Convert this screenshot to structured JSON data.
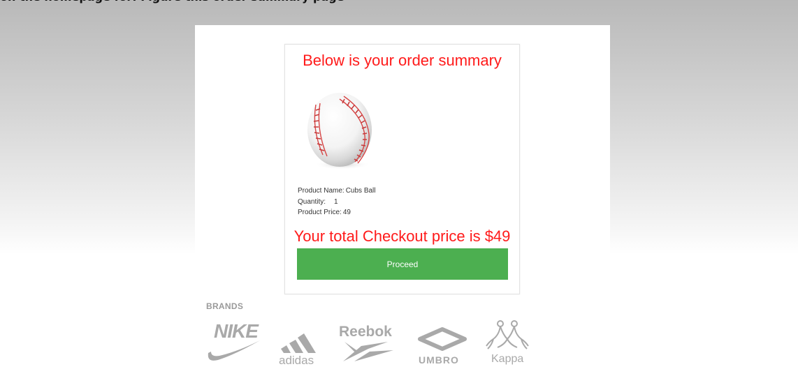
{
  "caption": "on the homepage for: Figure this order summary page",
  "order_summary": {
    "title": "Below is your order summary",
    "product_image_icon": "baseball-image",
    "product_name_label": "Product Name:",
    "product_name_value": "Cubs Ball",
    "quantity_label": "Quantity:",
    "quantity_value": "1",
    "price_label": "Product Price:",
    "price_value": "49",
    "total_text": "Your total Checkout price is $49",
    "proceed_label": "Proceed"
  },
  "brands": {
    "heading": "BRANDS",
    "items": [
      {
        "name": "NIKE",
        "icon": "nike-logo"
      },
      {
        "name": "adidas",
        "icon": "adidas-logo"
      },
      {
        "name": "Reebok",
        "icon": "reebok-logo"
      },
      {
        "name": "UMBRO",
        "icon": "umbro-logo"
      },
      {
        "name": "Kappa",
        "icon": "kappa-logo"
      }
    ]
  },
  "colors": {
    "accent_red": "#ff1a1a",
    "button_green": "#4caf50",
    "logo_gray": "#a9a9a9"
  }
}
